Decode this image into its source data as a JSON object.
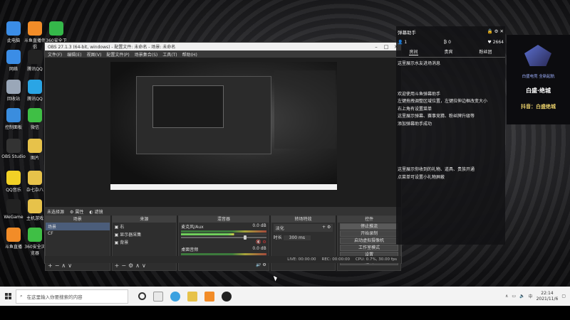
{
  "desktop": {
    "icons": [
      {
        "label": "此电脑",
        "color": "#3b8de6"
      },
      {
        "label": "斗鱼直播伴侣",
        "color": "#f28c28"
      },
      {
        "label": "360安全卫士",
        "color": "#35b84a"
      },
      {
        "label": "网络",
        "color": "#3b8de6"
      },
      {
        "label": "腾讯QQ",
        "color": "#222"
      },
      {
        "label": "回收站",
        "color": "#9aa7b8"
      },
      {
        "label": "腾讯QQ",
        "color": "#2aa5e5"
      },
      {
        "label": "控制面板",
        "color": "#3a8dde"
      },
      {
        "label": "微信",
        "color": "#3fbf45"
      },
      {
        "label": "OBS Studio",
        "color": "#333"
      },
      {
        "label": "图片",
        "color": "#e7c24a"
      },
      {
        "label": "QQ音乐",
        "color": "#f2d126"
      },
      {
        "label": "杂七杂八",
        "color": "#e7c24a"
      },
      {
        "label": "WeGame",
        "color": "#222"
      },
      {
        "label": "主机游戏",
        "color": "#e7c24a"
      },
      {
        "label": "斗鱼直播",
        "color": "#f28c28"
      },
      {
        "label": "360安全浏览器",
        "color": "#3fbf45"
      }
    ]
  },
  "obs": {
    "title": "OBS 27.1.3 (64-bit, windows) - 配置文件: 未命名 - 场景: 未命名",
    "menu": [
      "文件(F)",
      "编辑(E)",
      "视图(V)",
      "配置文件(P)",
      "场景集合(S)",
      "工具(T)",
      "帮助(H)"
    ],
    "source_bar": {
      "label": "未选择源",
      "properties": "属性",
      "filters": "滤镜"
    },
    "scenes": {
      "header": "场景",
      "items": [
        "场景",
        "CF"
      ]
    },
    "sources": {
      "header": "来源",
      "items": [
        "右",
        "显示器采集",
        "背景"
      ]
    },
    "mixer": {
      "header": "混音器",
      "tracks": [
        {
          "name": "麦克风/Aux",
          "db": "0.0 dB",
          "level": 0.6
        },
        {
          "name": "桌面音频",
          "db": "0.0 dB",
          "level": 0.55
        }
      ]
    },
    "transitions": {
      "header": "转场特效",
      "type": "淡化",
      "duration_label": "时长",
      "duration": "300 ms"
    },
    "controls": {
      "header": "控件",
      "buttons": [
        "停止推流",
        "开始录制",
        "启动虚拟摄像机",
        "工作室模式",
        "设置",
        "退出"
      ]
    },
    "status": {
      "live": "LIVE: 00:00:00",
      "rec": "REC: 00:00:00",
      "cpu": "CPU: 0.7%, 30.00 fps"
    }
  },
  "chat": {
    "title": "弹幕助手",
    "stats": [
      "1",
      "0",
      "2664"
    ],
    "tabs": [
      "房间",
      "贵宾",
      "粉丝团"
    ],
    "messages_top": [
      "这里展示水友进场消息"
    ],
    "messages_mid": [
      "欢迎使用斗鱼弹幕助手",
      "左键拖拽调整区域位置，左键拉伸边框改变大小",
      "右上角有设置菜单",
      "这里展示弹幕、赛事竞猜、粉丝牌升级等",
      "添加弹幕助手成功"
    ],
    "messages_bottom": [
      "这里展示你收到的礼物、道具、贵族开通",
      "点菜单可设置小礼物屏蔽"
    ]
  },
  "promo": {
    "tag": "白盛电竞  全新起航",
    "name": "白盛·绝城",
    "handle": "抖音：白盛绝城"
  },
  "taskbar": {
    "search_placeholder": "在这里输入你要搜索的内容",
    "time": "22:14",
    "date": "2021/11/6"
  }
}
